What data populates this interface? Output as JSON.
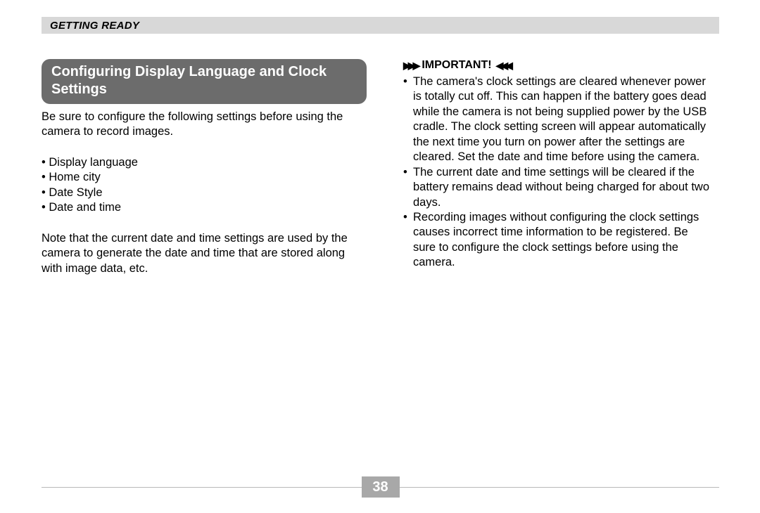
{
  "header": {
    "title": "GETTING READY"
  },
  "left_column": {
    "section_title": "Configuring Display Language and Clock Settings",
    "intro": "Be sure to configure the following settings before using the camera to record images.",
    "bullets": {
      "b0": "Display language",
      "b1": "Home city",
      "b2": "Date Style",
      "b3": "Date and time"
    },
    "note": "Note that the current date and time settings are used by the camera to generate the date and time that are stored along with image data, etc."
  },
  "right_column": {
    "important_label": "IMPORTANT!",
    "items": {
      "i0": "The camera's clock settings are cleared whenever power is totally cut off. This can happen if the battery goes dead while the camera is not being supplied power by the USB cradle. The clock setting screen will appear automatically the next time you turn on power after the settings are cleared. Set the date and time before using the camera.",
      "i1": "The current date and time settings will be cleared if the battery remains dead without being charged for about two days.",
      "i2": "Recording images without configuring the clock settings causes incorrect time information to be registered. Be sure to configure the clock settings before using the camera."
    }
  },
  "footer": {
    "page_number": "38"
  }
}
